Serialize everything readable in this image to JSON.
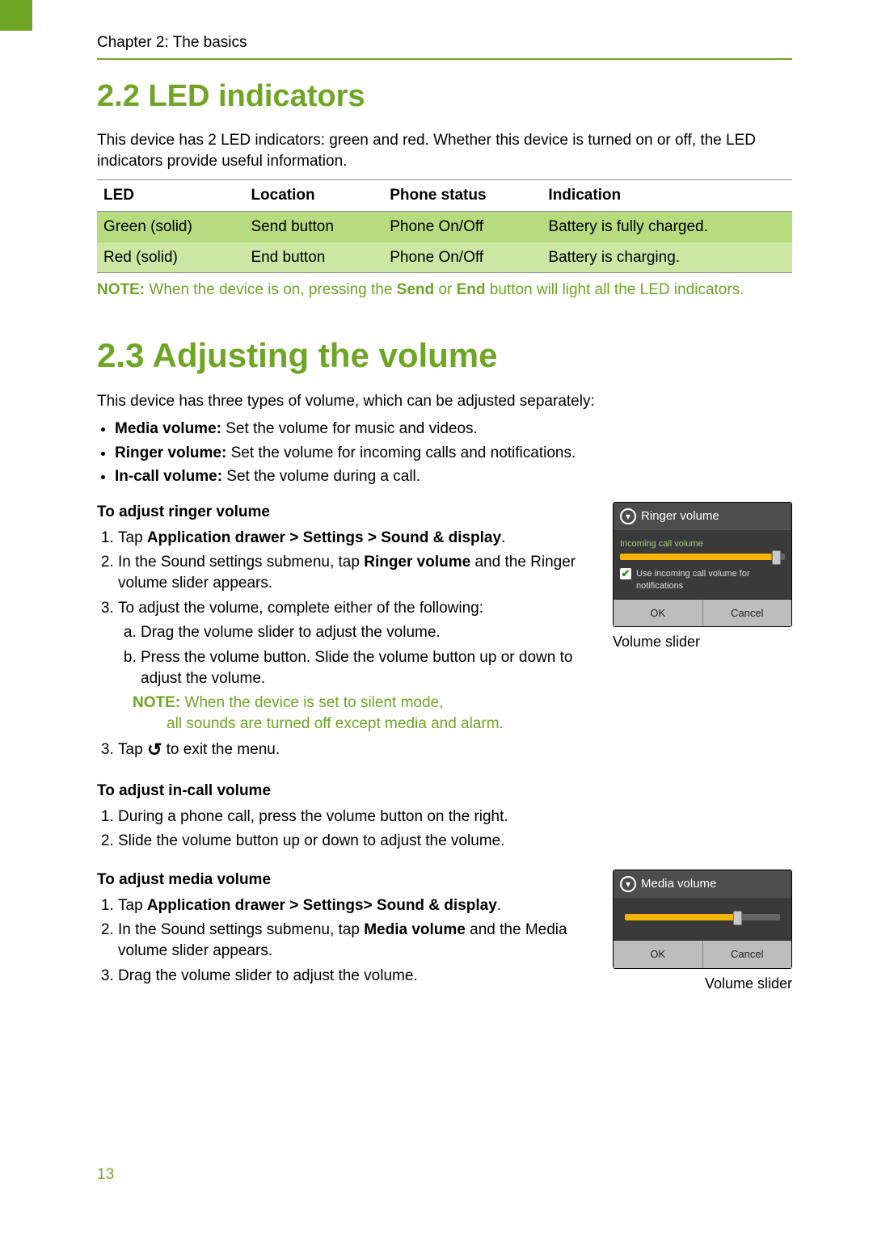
{
  "header": {
    "chapter": "Chapter 2: The basics"
  },
  "section22": {
    "title": "2.2 LED indicators",
    "intro": "This device has 2 LED indicators: green and red. Whether this device is turned on or off, the LED indicators provide useful information.",
    "table": {
      "headers": [
        "LED",
        "Location",
        "Phone status",
        "Indication"
      ],
      "rows": [
        [
          "Green (solid)",
          "Send button",
          "Phone On/Off",
          "Battery is fully charged."
        ],
        [
          "Red (solid)",
          "End button",
          "Phone On/Off",
          "Battery is charging."
        ]
      ]
    },
    "note_label": "NOTE:",
    "note_text_1": " When the device is on, pressing the ",
    "note_bold_1": "Send",
    "note_mid": " or ",
    "note_bold_2": "End",
    "note_text_2": " button will light all the LED indicators."
  },
  "section23": {
    "title": "2.3 Adjusting the volume",
    "intro": "This device has three types of volume, which can be adjusted separately:",
    "bullets": [
      {
        "bold": "Media volume:",
        "rest": " Set the volume for music and videos."
      },
      {
        "bold": "Ringer volume:",
        "rest": " Set the volume for incoming calls and notifications."
      },
      {
        "bold": "In-call volume:",
        "rest": " Set the volume during a call."
      }
    ],
    "ringer": {
      "heading": "To adjust ringer volume",
      "step1_a": "Tap ",
      "step1_b": "Application drawer > Settings > Sound & display",
      "step1_c": ".",
      "step2_a": "In the Sound settings submenu, tap ",
      "step2_b": "Ringer volume",
      "step2_c": " and the Ringer volume slider appears.",
      "step3": "To adjust the volume, complete either of the following:",
      "step3a": "Drag the volume slider to adjust the volume.",
      "step3b": "Press the volume button. Slide the volume button up or down to adjust the volume.",
      "note_label": "NOTE:",
      "note_line1": " When the device is set to silent mode,",
      "note_line2": "all sounds are turned off except media and alarm.",
      "step4_a": "Tap ",
      "step4_b": " to exit the menu.",
      "dialog": {
        "title": "Ringer volume",
        "small_label": "Incoming call volume",
        "checkbox_text": "Use incoming call volume for notifications",
        "ok": "OK",
        "cancel": "Cancel"
      },
      "caption": "Volume slider"
    },
    "incall": {
      "heading": "To adjust in-call volume",
      "step1": "During a phone call, press the volume button on the right.",
      "step2": "Slide the volume button up or down to adjust the volume."
    },
    "media": {
      "heading": "To adjust media volume",
      "step1_a": "Tap ",
      "step1_b": "Application drawer > Settings> Sound & display",
      "step1_c": ".",
      "step2_a": "In the Sound settings submenu, tap ",
      "step2_b": "Media volume",
      "step2_c": " and the Media volume slider appears.",
      "step3": "Drag the volume slider to adjust the volume.",
      "dialog": {
        "title": "Media volume",
        "ok": "OK",
        "cancel": "Cancel"
      },
      "caption": "Volume slider"
    }
  },
  "page_number": "13"
}
